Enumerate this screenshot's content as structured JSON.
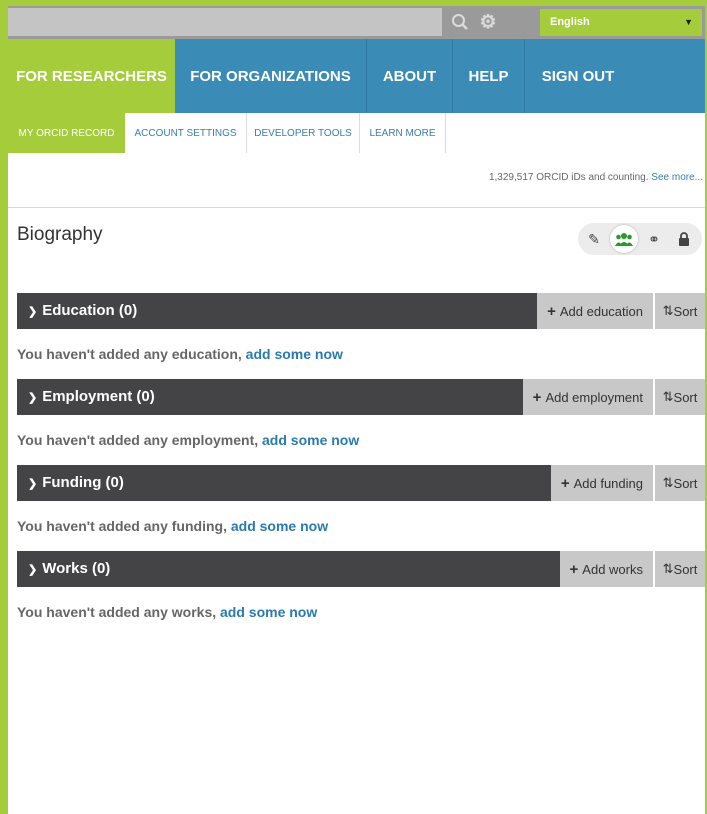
{
  "topbar": {
    "search_icon": "search-icon",
    "settings_icon": "gear-icon",
    "language": "English"
  },
  "mainnav": {
    "items": [
      {
        "label": "FOR RESEARCHERS"
      },
      {
        "label": "FOR ORGANIZATIONS"
      },
      {
        "label": "ABOUT"
      },
      {
        "label": "HELP"
      },
      {
        "label": "SIGN OUT"
      }
    ]
  },
  "subnav": {
    "items": [
      {
        "label": "MY ORCID RECORD"
      },
      {
        "label": "ACCOUNT SETTINGS"
      },
      {
        "label": "DEVELOPER TOOLS"
      },
      {
        "label": "LEARN MORE"
      }
    ]
  },
  "counter": {
    "text": "1,329,517 ORCID iDs and counting.",
    "link": "See more..."
  },
  "biography": {
    "title": "Biography",
    "visibility_icons": [
      "pencil-icon",
      "everyone-icon",
      "trusted-icon",
      "lock-icon"
    ]
  },
  "sections": [
    {
      "title": "Education (0)",
      "add_label": "Add education",
      "sort_label": "Sort",
      "empty_text": "You haven't added any education,",
      "empty_link": "add some now"
    },
    {
      "title": "Employment (0)",
      "add_label": "Add employment",
      "sort_label": "Sort",
      "empty_text": "You haven't added any employment,",
      "empty_link": "add some now"
    },
    {
      "title": "Funding (0)",
      "add_label": "Add funding",
      "sort_label": "Sort",
      "empty_text": "You haven't added any funding,",
      "empty_link": "add some now"
    },
    {
      "title": "Works (0)",
      "add_label": "Add works",
      "sort_label": "Sort",
      "empty_text": "You haven't added any works,",
      "empty_link": "add some now"
    }
  ],
  "colors": {
    "brand_green": "#a5cc3a",
    "nav_blue": "#3a8bb5",
    "section_bar": "#444447",
    "link_blue": "#2a7ab0"
  }
}
